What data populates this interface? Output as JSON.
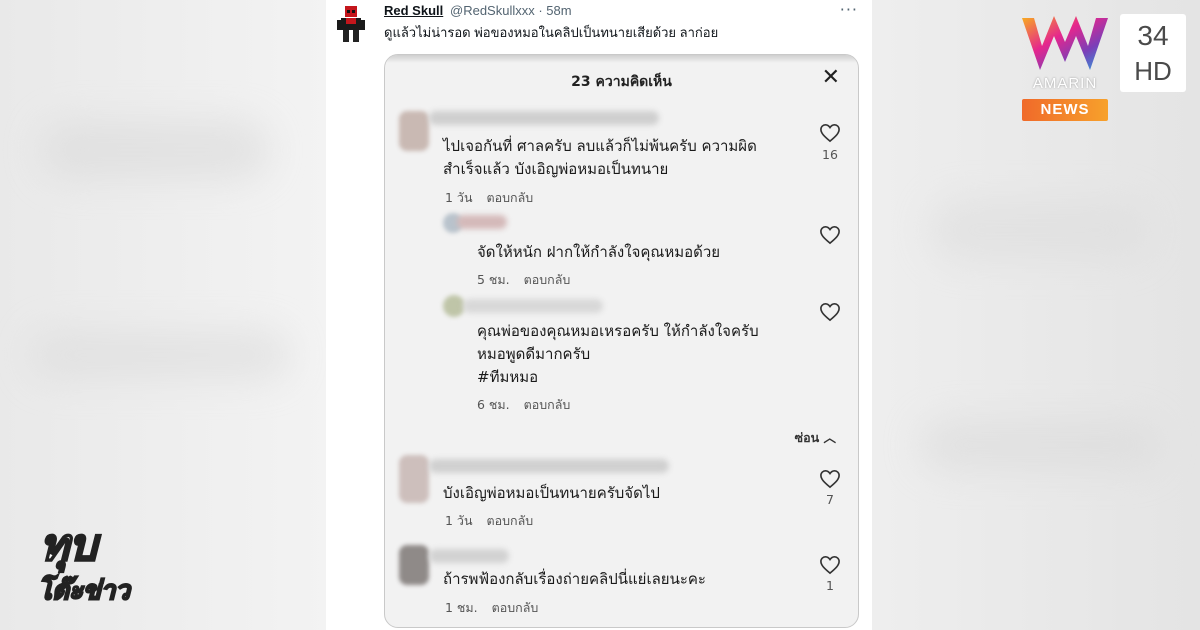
{
  "tweet": {
    "display_name": "Red Skull",
    "handle_time": "@RedSkullxxx · 58m",
    "more": "···",
    "text": "ดูแล้วไม่น่ารอด พ่อของหมอในคลิปเป็นทนายเสียด้วย ลาก่อย"
  },
  "comments_panel": {
    "title": "23 ความคิดเห็น",
    "close": "✕",
    "hide_label": "ซ่อน ︿",
    "comments": [
      {
        "text": "ไปเจอกันที่ ศาลครับ ลบแล้วก็ไม่พ้นครับ ความผิด\nสำเร็จแล้ว บังเอิญพ่อหมอเป็นทนาย",
        "time": "1 วัน",
        "reply": "ตอบกลับ",
        "likes": "16"
      },
      {
        "text": "จัดให้หนัก ฝากให้กำลังใจคุณหมอด้วย",
        "time": "5 ชม.",
        "reply": "ตอบกลับ",
        "likes": ""
      },
      {
        "text": "คุณพ่อของคุณหมอเหรอครับ ให้กำลังใจครับ\nหมอพูดดีมากครับ\n#ทีมหมอ",
        "time": "6 ชม.",
        "reply": "ตอบกลับ",
        "likes": ""
      },
      {
        "text": "บังเอิญพ่อหมอเป็นทนายครับจัดไป",
        "time": "1 วัน",
        "reply": "ตอบกลับ",
        "likes": "7"
      },
      {
        "text": "ถ้ารพฟ้องกลับเรื่องถ่ายคลิปนี่แย่เลยนะคะ",
        "time": "1 ชม.",
        "reply": "ตอบกลับ",
        "likes": "1"
      }
    ]
  },
  "branding": {
    "amarin_word": "AMARIN",
    "news_badge": "NEWS",
    "channel_number": "34",
    "channel_hd": "HD",
    "show_line1": "ทุบ",
    "show_line2": "โต๊ะข่าว"
  },
  "colors": {
    "news_orange": "#f06a2a",
    "heart_outline": "#333333",
    "card_bg": "#f2f2f2"
  }
}
